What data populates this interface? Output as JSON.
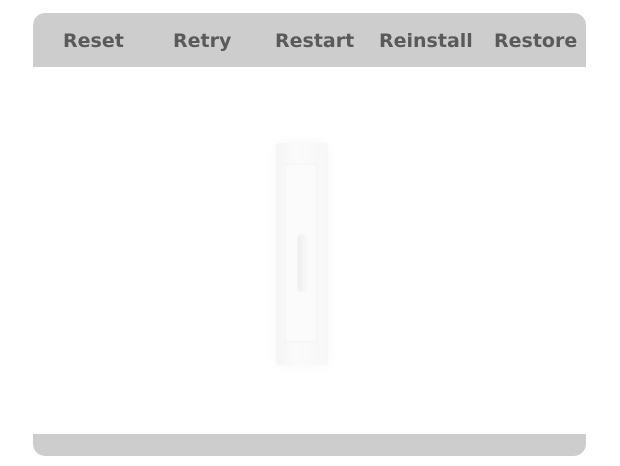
{
  "toolbar": {
    "buttons": [
      {
        "label": "Reset"
      },
      {
        "label": "Retry"
      },
      {
        "label": "Restart"
      },
      {
        "label": "Reinstall"
      },
      {
        "label": "Restore"
      }
    ]
  },
  "content": {
    "illustration": "light-switch-icon"
  },
  "colors": {
    "toolbar_bg": "#cdcdcd",
    "toolbar_text": "#5a5a5a",
    "content_bg": "#ffffff"
  }
}
